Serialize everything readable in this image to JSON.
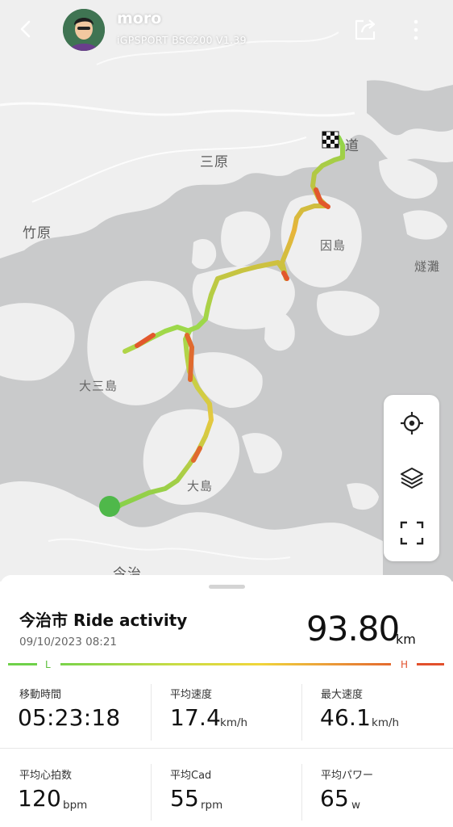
{
  "header": {
    "user_name": "moro",
    "device": "iGPSPORT BSC200 V1.39"
  },
  "map": {
    "place_labels": [
      "道",
      "三原",
      "竹原",
      "因島",
      "燧灘",
      "大三島",
      "大島",
      "今治"
    ]
  },
  "activity": {
    "title": "今治市 Ride activity",
    "date": "09/10/2023 08:21",
    "distance": "93.80",
    "distance_unit": "km",
    "scale_low": "L",
    "scale_high": "H"
  },
  "stats": [
    {
      "label": "移動時間",
      "value": "05:23:18",
      "unit": ""
    },
    {
      "label": "平均速度",
      "value": "17.4",
      "unit": "km/h"
    },
    {
      "label": "最大速度",
      "value": "46.1",
      "unit": "km/h"
    },
    {
      "label": "平均心拍数",
      "value": "120",
      "unit": "bpm"
    },
    {
      "label": "平均Cad",
      "value": "55",
      "unit": "rpm"
    },
    {
      "label": "平均パワー",
      "value": "65",
      "unit": "w"
    }
  ],
  "colors": {
    "low": "#6fd14a",
    "mid": "#f0d63a",
    "high": "#e2502c",
    "start_marker": "#4fb84a"
  }
}
